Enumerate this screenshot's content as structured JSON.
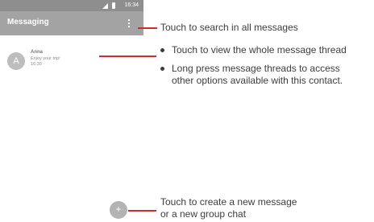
{
  "status_bar": {
    "time": "16:34"
  },
  "app_bar": {
    "title": "Messaging"
  },
  "thread": {
    "avatar_letter": "A",
    "name": "Anna",
    "snippet": "Enjoy your trip!",
    "time": "16:30"
  },
  "fab": {
    "symbol": "+"
  },
  "annotations": {
    "search": "Touch to search in all messages",
    "view_thread": "Touch to view the whole message thread",
    "long_press_line1": "Long press message threads to access",
    "long_press_line2": "other options available with this contact.",
    "new_message_line1": "Touch to create a new message",
    "new_message_line2": "or a new group chat"
  },
  "colors": {
    "callout_line": "#d9272e",
    "status_bar": "#8e8e8e",
    "app_bar": "#a3a3a3"
  }
}
